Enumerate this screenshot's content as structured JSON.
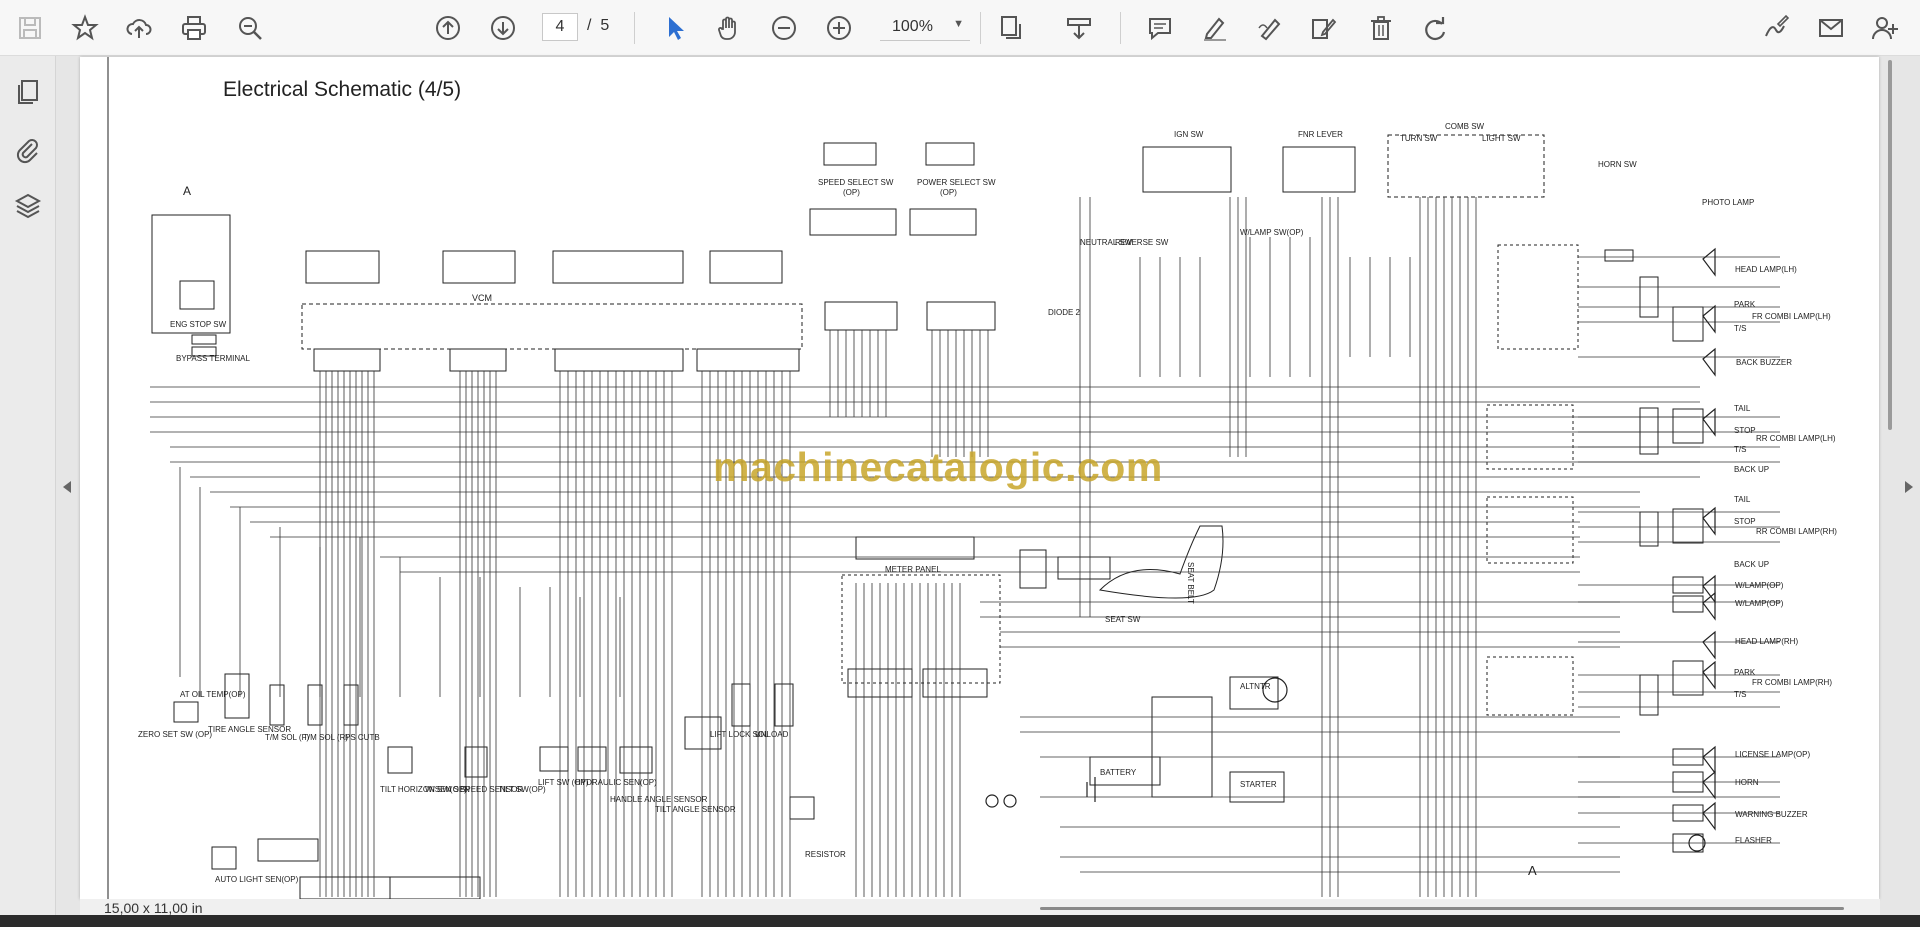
{
  "toolbar": {
    "current_page": "4",
    "total_pages": "5",
    "page_separator": "/",
    "zoom": "100%",
    "icons": [
      "save-icon",
      "bookmark-star-icon",
      "upload-cloud-icon",
      "print-icon",
      "zoom-out-search-icon",
      "page-up-icon",
      "page-down-icon",
      "select-cursor-icon",
      "hand-pan-icon",
      "zoom-minus-icon",
      "zoom-plus-icon",
      "fit-page-icon",
      "download-tray-icon",
      "comment-icon",
      "highlight-pen-icon",
      "draw-pen-icon",
      "edit-doc-icon",
      "delete-icon",
      "redo-icon",
      "signature-icon",
      "email-icon",
      "user-add-icon"
    ]
  },
  "sidebar": {
    "icons": [
      "pages-icon",
      "attachment-icon",
      "layers-icon"
    ]
  },
  "document": {
    "title": "Electrical Schematic (4/5)",
    "watermark": "machinecatalogic.com",
    "page_size": "15,00 x 11,00 in",
    "labels": {
      "ref_a_top": "A",
      "ref_a_bottom": "A",
      "eng_stop": "ENG STOP SW",
      "bypass": "BYPASS TERMINAL",
      "vcm": "VCM",
      "speed_select": "SPEED SELECT SW",
      "speed_select_op": "(OP)",
      "power_select": "POWER SELECT SW",
      "power_select_op": "(OP)",
      "ign_sw": "IGN SW",
      "fnr_lever": "FNR LEVER",
      "comb_sw": "COMB SW",
      "turn_sw": "TURN SW",
      "light_sw": "LIGHT SW",
      "horn_sw": "HORN SW",
      "photo_lamp": "PHOTO LAMP",
      "head_lamp_l": "HEAD LAMP(LH)",
      "park": "PARK",
      "ts": "T/S",
      "fr_comb_lh": "FR COMBI LAMP(LH)",
      "back_buzzer": "BACK BUZZER",
      "tail": "TAIL",
      "stop": "STOP",
      "back_up": "BACK UP",
      "rr_comb_lh": "RR COMBI LAMP(LH)",
      "rr_comb_rh": "RR COMBI LAMP(RH)",
      "wlamp_op": "W/LAMP(OP)",
      "head_lamp_r": "HEAD LAMP(RH)",
      "fr_comb_rh": "FR COMBI LAMP(RH)",
      "license_lamp": "LICENSE LAMP(OP)",
      "horn": "HORN",
      "warning_buzzer": "WARNING BUZZER",
      "flasher": "FLASHER",
      "meter_panel": "METER PANEL",
      "seat_sw": "SEAT SW",
      "seat_belt": "SEAT BELT",
      "altntr": "ALTNTR",
      "battery": "BATTERY",
      "starter": "STARTER",
      "resistor": "RESISTOR",
      "tire_angle": "TIRE ANGLE SENSOR",
      "tm_sol_f": "T/M SOL (F)",
      "tm_sol_r": "T/M SOL (R)",
      "ps_cutb": "PS CUTB",
      "tilt_horizon": "TILT HORIZON SW(OP)",
      "wsen": "W/SEN SEN",
      "speed_sensor": "SPEED SENSOR",
      "tilt_sw": "TILT SW(OP)",
      "lift_sw": "LIFT SW (OP)",
      "hydraulic": "HYDRAULIC SEN(OP)",
      "handle_angle": "HANDLE ANGLE SENSOR",
      "tilt_angle": "TILT ANGLE SENSOR",
      "lift_lock": "LIFT LOCK SOL",
      "unload": "UNLOAD",
      "zero_set": "ZERO SET SW (OP)",
      "auto_light": "AUTO LIGHT SEN(OP)",
      "diode": "DIODE 2",
      "neutral_sw": "NEUTRAL SW",
      "reverse_sw": "REVERSE SW",
      "wlamp_sw": "W/LAMP SW(OP)",
      "at_oil": "AT OIL TEMP(OP)"
    }
  },
  "colors": {
    "accent_blue": "#2d6fd1",
    "icon_gray": "#555555",
    "watermark": "#c8a62b"
  }
}
